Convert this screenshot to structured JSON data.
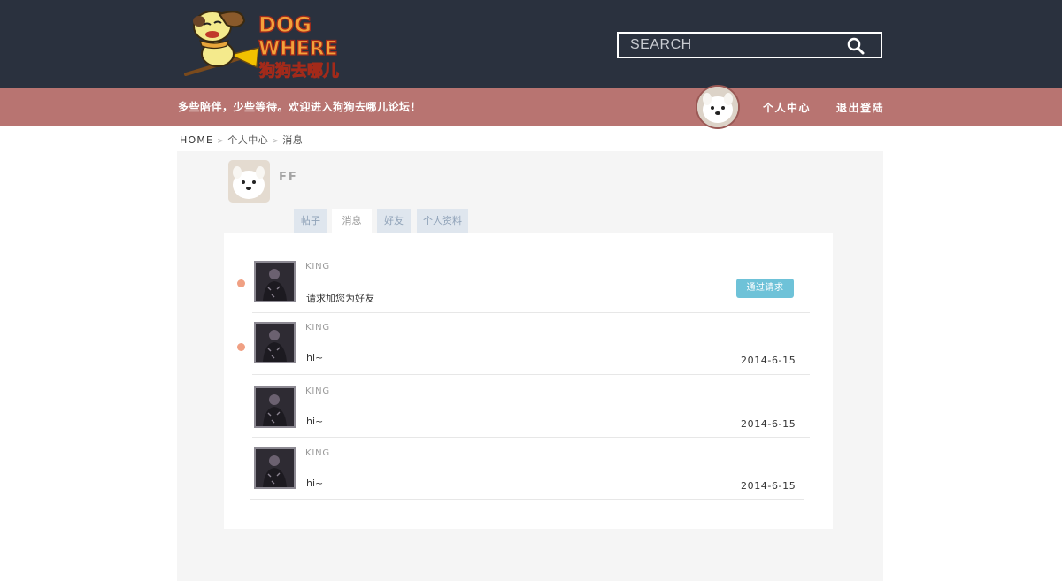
{
  "header": {
    "logo_text": "DOG WHERE 狗狗去哪儿",
    "search_placeholder": "SEARCH",
    "welcome": "多些陪伴，少些等待。欢迎进入狗狗去哪儿论坛！",
    "nav": {
      "profile_center": "个人中心",
      "logout": "退出登陆"
    }
  },
  "breadcrumb": {
    "home": "HOME",
    "sep": ">",
    "level1": "个人中心",
    "level2": "消息"
  },
  "profile": {
    "name": "FF"
  },
  "tabs": [
    {
      "label": "帖子",
      "active": false
    },
    {
      "label": "消息",
      "active": true
    },
    {
      "label": "好友",
      "active": false
    },
    {
      "label": "个人资料",
      "active": false
    }
  ],
  "messages": [
    {
      "sender": "KING",
      "text": "请求加您为好友",
      "unread": true,
      "action_label": "通过请求"
    },
    {
      "sender": "KING",
      "text": "hi~",
      "unread": true,
      "date": "2014-6-15"
    },
    {
      "sender": "KING",
      "text": "hi~",
      "unread": false,
      "date": "2014-6-15"
    },
    {
      "sender": "KING",
      "text": "hi~",
      "unread": false,
      "date": "2014-6-15"
    }
  ],
  "colors": {
    "header_bg": "#2a313e",
    "subbar_bg": "#b87471",
    "unread_dot": "#f0a083",
    "accept_button": "#6ec2d8"
  }
}
